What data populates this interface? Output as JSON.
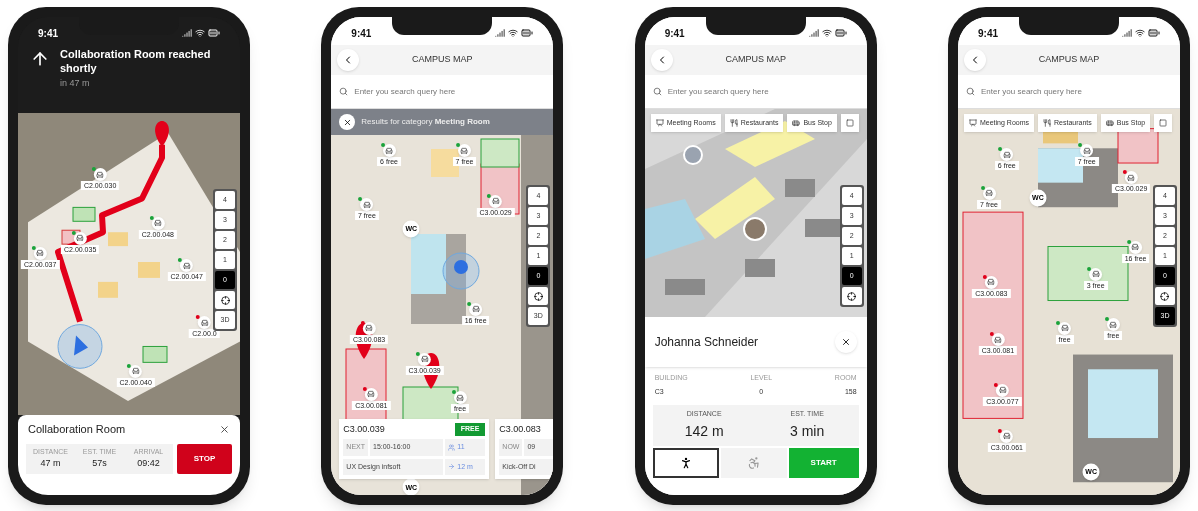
{
  "phones": [
    {
      "kind": "navigation",
      "time": "9:41",
      "banner": {
        "title": "Collaboration Room reached shortly",
        "subtitle": "in 47 m"
      },
      "map_labels": [
        {
          "kind": "room",
          "text": "C2.00.030",
          "color": "#1aa33a"
        },
        {
          "kind": "room",
          "text": "C2.00.048",
          "color": "#1aa33a"
        },
        {
          "kind": "room",
          "text": "C2.00.035",
          "color": "#1aa33a"
        },
        {
          "kind": "room",
          "text": "C2.00.037",
          "color": "#1aa33a"
        },
        {
          "kind": "room",
          "text": "C2.00.047",
          "color": "#1aa33a"
        },
        {
          "kind": "room",
          "text": "C2.00.0",
          "color": "#e0001b"
        },
        {
          "kind": "room",
          "text": "C2.00.040",
          "color": "#1aa33a"
        }
      ],
      "levels": [
        {
          "label": "4",
          "selected": false
        },
        {
          "label": "3",
          "selected": false
        },
        {
          "label": "2",
          "selected": false
        },
        {
          "label": "1",
          "selected": false
        },
        {
          "label": "0",
          "selected": true
        }
      ],
      "three_d": {
        "label": "3D",
        "on": false
      },
      "sheet": {
        "title": "Collaboration Room",
        "stats": [
          {
            "label": "DISTANCE",
            "value": "47 m"
          },
          {
            "label": "EST. TIME",
            "value": "57s"
          },
          {
            "label": "ARRIVAL",
            "value": "09:42"
          }
        ],
        "button": "STOP"
      }
    },
    {
      "kind": "results",
      "time": "9:41",
      "header": "CAMPUS MAP",
      "search": {
        "placeholder": "Enter you search query here"
      },
      "results_text": "Results for category **Meeting Room**",
      "map_labels": [
        {
          "kind": "room",
          "text": "6 free",
          "color": "#1aa33a"
        },
        {
          "kind": "room",
          "text": "7 free",
          "color": "#1aa33a"
        },
        {
          "kind": "room",
          "text": "7 free",
          "color": "#1aa33a"
        },
        {
          "kind": "circle",
          "text": "WC"
        },
        {
          "kind": "room",
          "text": "C3.00.029",
          "color": "#1aa33a"
        },
        {
          "kind": "room",
          "text": "16 free",
          "color": "#1aa33a"
        },
        {
          "kind": "room",
          "text": "C3.00.083",
          "color": "#e0001b"
        },
        {
          "kind": "room",
          "text": "C3.00.039",
          "color": "#1aa33a"
        },
        {
          "kind": "room",
          "text": "C3.00.081",
          "color": "#e0001b"
        },
        {
          "kind": "room",
          "text": "free",
          "color": "#1aa33a"
        },
        {
          "kind": "circle",
          "text": "WC"
        }
      ],
      "levels": [
        {
          "label": "4",
          "selected": false
        },
        {
          "label": "3",
          "selected": false
        },
        {
          "label": "2",
          "selected": false
        },
        {
          "label": "1",
          "selected": false
        },
        {
          "label": "0",
          "selected": true
        }
      ],
      "three_d": {
        "label": "3D",
        "on": false
      },
      "cards": [
        {
          "room": "C3.00.039",
          "badge": "FREE",
          "status": "NEXT",
          "time": "15:00-16:00",
          "seats": "11",
          "event": "UX Design infsoft",
          "distance": "12 m"
        },
        {
          "room": "C3.00.083",
          "status": "NOW",
          "time": "09",
          "event": "Kick-Off Di"
        }
      ]
    },
    {
      "kind": "person",
      "time": "9:41",
      "header": "CAMPUS MAP",
      "search": {
        "placeholder": "Enter you search query here"
      },
      "chips": [
        {
          "kind": "meeting",
          "label": "Meeting Rooms"
        },
        {
          "kind": "restaurant",
          "label": "Restaurants"
        },
        {
          "kind": "bus",
          "label": "Bus Stop"
        },
        {
          "kind": "other"
        }
      ],
      "levels": [
        {
          "label": "4",
          "selected": false
        },
        {
          "label": "3",
          "selected": false
        },
        {
          "label": "2",
          "selected": false
        },
        {
          "label": "1",
          "selected": false
        },
        {
          "label": "0",
          "selected": true
        }
      ],
      "person": {
        "name": "Johanna Schneider",
        "info": [
          {
            "label": "BUILDING",
            "value": "C3"
          },
          {
            "label": "LEVEL",
            "value": "0"
          },
          {
            "label": "ROOM",
            "value": "158"
          }
        ],
        "stats": [
          {
            "label": "DISTANCE",
            "value": "142 m"
          },
          {
            "label": "EST. TIME",
            "value": "3 min"
          }
        ],
        "modes": [
          {
            "kind": "walk",
            "selected": true
          },
          {
            "kind": "wheelchair",
            "selected": false
          }
        ],
        "button": "START"
      }
    },
    {
      "kind": "floor",
      "time": "9:41",
      "header": "CAMPUS MAP",
      "search": {
        "placeholder": "Enter you search query here"
      },
      "chips": [
        {
          "kind": "meeting",
          "label": "Meeting Rooms"
        },
        {
          "kind": "restaurant",
          "label": "Restaurants"
        },
        {
          "kind": "bus",
          "label": "Bus Stop"
        },
        {
          "kind": "other"
        }
      ],
      "map_labels": [
        {
          "kind": "room",
          "text": "6 free",
          "color": "#1aa33a"
        },
        {
          "kind": "room",
          "text": "7 free",
          "color": "#1aa33a"
        },
        {
          "kind": "room",
          "text": "C3.00.029",
          "color": "#e0001b"
        },
        {
          "kind": "room",
          "text": "7 free",
          "color": "#1aa33a"
        },
        {
          "kind": "circle",
          "text": "WC"
        },
        {
          "kind": "room",
          "text": "16 free",
          "color": "#1aa33a"
        },
        {
          "kind": "room",
          "text": "3 free",
          "color": "#1aa33a"
        },
        {
          "kind": "room",
          "text": "C3.00.083",
          "color": "#e0001b"
        },
        {
          "kind": "room",
          "text": "free",
          "color": "#1aa33a"
        },
        {
          "kind": "room",
          "text": "free",
          "color": "#1aa33a"
        },
        {
          "kind": "room",
          "text": "C3.00.081",
          "color": "#e0001b"
        },
        {
          "kind": "room",
          "text": "C3.00.077",
          "color": "#e0001b"
        },
        {
          "kind": "room",
          "text": "C3.00.061",
          "color": "#e0001b"
        },
        {
          "kind": "circle",
          "text": "WC"
        }
      ],
      "levels": [
        {
          "label": "4",
          "selected": false
        },
        {
          "label": "3",
          "selected": false
        },
        {
          "label": "2",
          "selected": false
        },
        {
          "label": "1",
          "selected": false
        },
        {
          "label": "0",
          "selected": true
        }
      ],
      "three_d": {
        "label": "3D",
        "on": true
      }
    }
  ]
}
